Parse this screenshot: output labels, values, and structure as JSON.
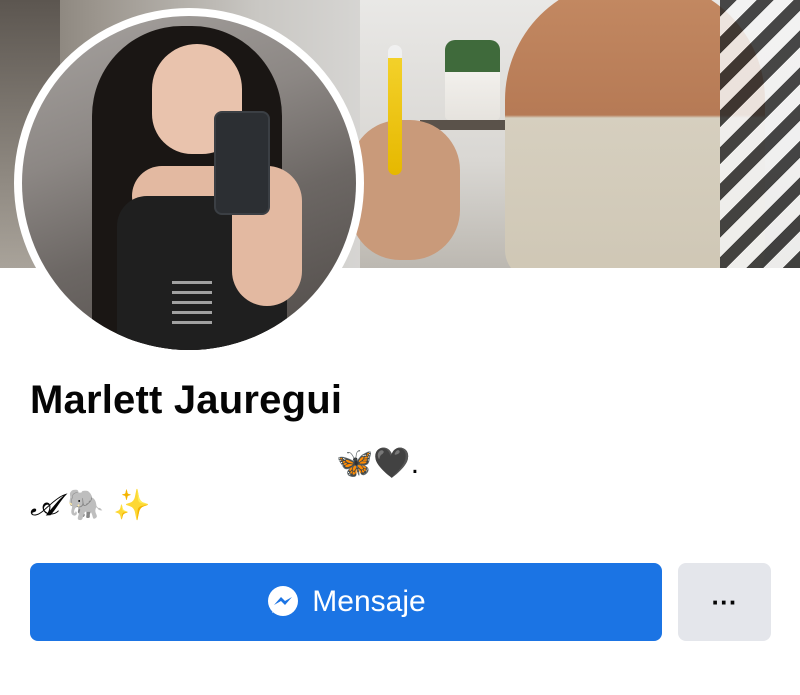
{
  "profile": {
    "name": "Marlett Jauregui",
    "bio_line_1": "🦋🖤.",
    "bio_line_2_letter": "𝓐",
    "bio_line_2_emoji": " 🐘  ✨"
  },
  "actions": {
    "message_label": "Mensaje",
    "more_label": "···"
  },
  "icons": {
    "message": "messenger-icon",
    "more": "more-icon"
  },
  "colors": {
    "primary_button": "#1b74e4",
    "secondary_button": "#e4e6eb",
    "text": "#050505"
  }
}
